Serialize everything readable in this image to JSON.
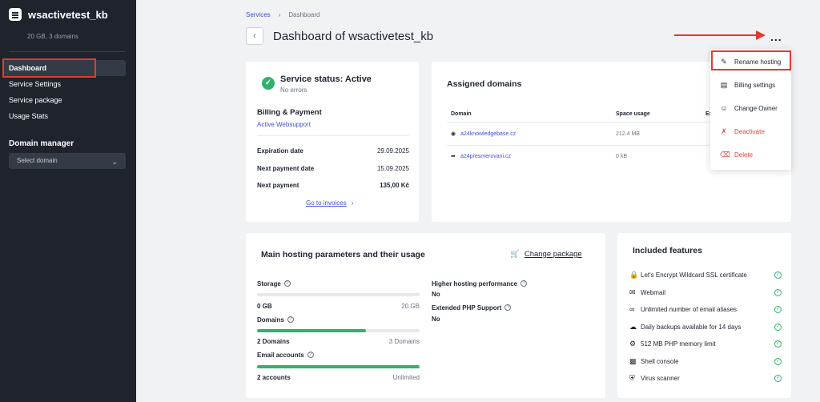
{
  "sidebar": {
    "brand_title": "wsactivetest_kb",
    "brand_sub": "20 GB, 3 domains",
    "items": [
      {
        "label": "Dashboard"
      },
      {
        "label": "Service Settings"
      },
      {
        "label": "Service package"
      },
      {
        "label": "Usage Stats"
      }
    ],
    "domain_manager_title": "Domain manager",
    "domain_select": "Select domain"
  },
  "header": {
    "breadcrumb": [
      "Services",
      "Dashboard"
    ],
    "title": "Dashboard of wsactivetest_kb",
    "more": "..."
  },
  "status_card": {
    "title": "Service status: Active",
    "subtitle": "No errors",
    "billing_title": "Billing & Payment",
    "billing_link": "Active Websupport",
    "rows": [
      {
        "key": "Expiration date",
        "value": "29.09.2025"
      },
      {
        "key": "Next payment date",
        "value": "15.09.2025"
      },
      {
        "key": "Next payment",
        "value": "135,00 Kč"
      }
    ],
    "invoices_link": "Go to invoices"
  },
  "domains_card": {
    "title": "Assigned domains",
    "headers": [
      "Domain",
      "Space usage",
      "Ex"
    ],
    "rows": [
      {
        "domain": "a24knowledgebase.cz",
        "usage": "212.4 MB",
        "icon": "globe-icon"
      },
      {
        "domain": "a24presmerovani.cz",
        "usage": "0 kB",
        "icon": "redirect-icon"
      }
    ]
  },
  "menu": {
    "items": [
      {
        "label": "Rename hosting",
        "icon": "pencil-icon",
        "danger": false
      },
      {
        "label": "Billing settings",
        "icon": "billing-icon",
        "danger": false
      },
      {
        "label": "Change Owner",
        "icon": "user-icon",
        "danger": false
      },
      {
        "label": "Deactivate",
        "icon": "deactivate-icon",
        "danger": true
      },
      {
        "label": "Delete",
        "icon": "trash-icon",
        "danger": true
      }
    ]
  },
  "params_card": {
    "title": "Main hosting parameters and their usage",
    "change_package": "Change package",
    "help": "?",
    "left": [
      {
        "label": "Storage",
        "value": "0 GB",
        "max": "20 GB",
        "fill": 0
      },
      {
        "label": "Domains",
        "value": "2 Domains",
        "max": "3 Domains",
        "fill": 0.67
      },
      {
        "label": "Email accounts",
        "value": "2 accounts",
        "max": "Unlimited",
        "fill": 1
      }
    ],
    "right": [
      {
        "label": "Higher hosting performance",
        "value": "No"
      },
      {
        "label": "Extended PHP Support",
        "value": "No"
      }
    ]
  },
  "features_card": {
    "title": "Included features",
    "items": [
      {
        "label": "Let's Encrypt Wildcard SSL certificate",
        "icon": "lock-icon"
      },
      {
        "label": "Webmail",
        "icon": "mail-icon"
      },
      {
        "label": "Unlimited number of email aliases",
        "icon": "infinity-icon"
      },
      {
        "label": "Daily backups available for 14 days",
        "icon": "cloud-backup-icon"
      },
      {
        "label": "512 MB PHP memory limit",
        "icon": "php-icon"
      },
      {
        "label": "Shell console",
        "icon": "terminal-icon"
      },
      {
        "label": "Virus scanner",
        "icon": "shield-icon"
      }
    ]
  },
  "colors": {
    "sidebar_bg": "#1e232c",
    "accent_blue": "#3f51d6",
    "success_green": "#2fb36a",
    "danger_red": "#e2463b",
    "annotation_red": "#e23b2e"
  }
}
